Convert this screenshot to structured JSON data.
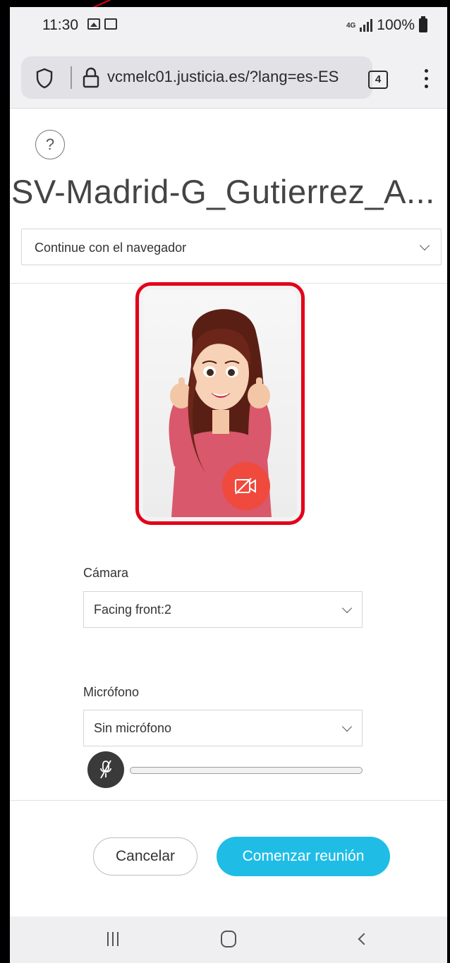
{
  "status_bar": {
    "time": "11:30",
    "network": "4G",
    "battery": "100%"
  },
  "browser": {
    "url": "vcmelc01.justicia.es/?lang=es-ES",
    "tab_count": "4"
  },
  "meeting": {
    "title": "SV-Madrid-G_Gutierrez_A...",
    "join_mode": "Continue con el navegador"
  },
  "preview": {
    "avatar": "cartoon-woman-thumbs-up",
    "camera_button_color": "#ef4a3d",
    "highlight_color": "#e2001a"
  },
  "camera": {
    "label": "Cámara",
    "selected": "Facing front:2"
  },
  "microphone": {
    "label": "Micrófono",
    "selected": "Sin micrófono",
    "level": 0
  },
  "actions": {
    "cancel_label": "Cancelar",
    "start_label": "Comenzar reunión",
    "accent_color": "#1fbde6"
  }
}
